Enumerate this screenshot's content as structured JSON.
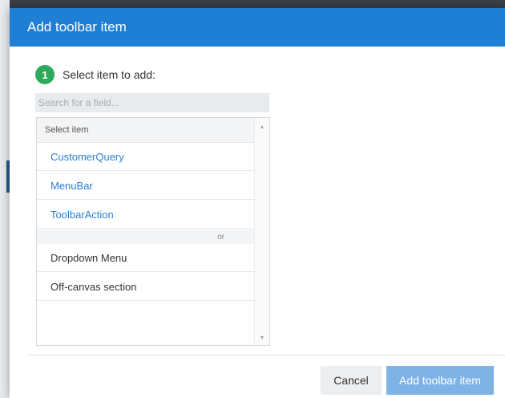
{
  "dialog": {
    "title": "Add toolbar item",
    "step": {
      "number": "1",
      "label": "Select item to add:"
    },
    "search": {
      "placeholder": "Search for a field..."
    },
    "list": {
      "header": "Select item",
      "links": [
        "CustomerQuery",
        "MenuBar",
        "ToolbarAction"
      ],
      "separator": "or",
      "items": [
        "Dropdown Menu",
        "Off-canvas section"
      ]
    },
    "footer": {
      "cancel_label": "Cancel",
      "submit_label": "Add toolbar item"
    }
  },
  "colors": {
    "header": "#1f7fd4",
    "step_badge": "#2eaa5c",
    "link": "#2a7fd0",
    "primary_button_disabled": "#7fb3e6"
  }
}
